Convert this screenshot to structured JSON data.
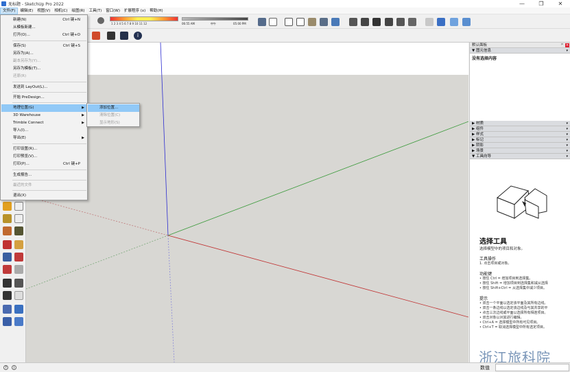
{
  "window": {
    "title": "无标题 - SketchUp Pro 2022",
    "minimize": "—",
    "maximize": "❐",
    "close": "✕"
  },
  "menubar": [
    {
      "key": "file",
      "label": "文件(F)"
    },
    {
      "key": "edit",
      "label": "编辑(E)"
    },
    {
      "key": "view",
      "label": "视图(V)"
    },
    {
      "key": "camera",
      "label": "相机(C)"
    },
    {
      "key": "draw",
      "label": "绘图(R)"
    },
    {
      "key": "tools",
      "label": "工具(T)"
    },
    {
      "key": "window",
      "label": "窗口(W)"
    },
    {
      "key": "extensions",
      "label": "扩展程序 (x)"
    },
    {
      "key": "help",
      "label": "帮助(H)"
    }
  ],
  "shadow_bar": {
    "months": "1 2 3 4 5 6 7 8 9 10 11 12",
    "time_start": "06:55 AM",
    "time_mid": "中午",
    "time_end": "05:00 PM"
  },
  "file_menu": {
    "items": [
      {
        "label": "新建(N)",
        "shortcut": "Ctrl 键+N",
        "disabled": false
      },
      {
        "label": "从模板新建...",
        "shortcut": "",
        "disabled": false
      },
      {
        "label": "打开(O)...",
        "shortcut": "Ctrl 键+O",
        "disabled": false
      },
      {
        "label": "保存(S)",
        "shortcut": "Ctrl 键+S",
        "disabled": false
      },
      {
        "label": "另存为(A)...",
        "shortcut": "",
        "disabled": false
      },
      {
        "label": "副本另存为(Y)...",
        "shortcut": "",
        "disabled": true
      },
      {
        "label": "另存为模板(T)...",
        "shortcut": "",
        "disabled": false
      },
      {
        "label": "还原(R)",
        "shortcut": "",
        "disabled": true
      },
      {
        "label": "发送到 LayOut(L)...",
        "shortcut": "",
        "disabled": false
      },
      {
        "label": "开始 PreDesign...",
        "shortcut": "",
        "disabled": false
      },
      {
        "label": "地理位置(G)",
        "shortcut": "",
        "disabled": false,
        "submenu": true
      },
      {
        "label": "3D Warehouse",
        "shortcut": "",
        "disabled": false,
        "submenu": true
      },
      {
        "label": "Trimble Connect",
        "shortcut": "",
        "disabled": false,
        "submenu": true
      },
      {
        "label": "导入(I)...",
        "shortcut": "",
        "disabled": false
      },
      {
        "label": "导出(E)",
        "shortcut": "",
        "disabled": false,
        "submenu": true
      },
      {
        "label": "打印设置(R)...",
        "shortcut": "",
        "disabled": false
      },
      {
        "label": "打印预览(V)...",
        "shortcut": "",
        "disabled": false
      },
      {
        "label": "打印(P)...",
        "shortcut": "Ctrl 键+P",
        "disabled": false
      },
      {
        "label": "生成报告...",
        "shortcut": "",
        "disabled": false
      },
      {
        "label": "最近的文件",
        "shortcut": "",
        "disabled": true
      },
      {
        "label": "退出(X)",
        "shortcut": "",
        "disabled": false
      }
    ]
  },
  "geo_submenu": {
    "items": [
      {
        "label": "添加位置...",
        "disabled": false
      },
      {
        "label": "清除位置(C)",
        "disabled": true
      },
      {
        "label": "显示地形(S)",
        "disabled": true
      }
    ]
  },
  "right_panel": {
    "header": "默认面板",
    "pin": "ᵖ",
    "close": "×",
    "entity_info": {
      "title": "图元信息",
      "body": "没有选择内容"
    },
    "trays": [
      "材质",
      "组件",
      "样式",
      "标记",
      "阴影",
      "场景",
      "工具向导"
    ],
    "instructor": {
      "title": "选择工具",
      "subtitle": "选择模型中的项目和对象。",
      "ops_h": "工具操作",
      "ops": [
        "1. 点击项目或对象。"
      ],
      "keys_h": "功能键",
      "keys": [
        "• 按住 Ctrl = 增加项目到选择集。",
        "• 按住 Shift = 增加项目到选择集和减从选择",
        "• 按住 Shift+Ctrl = 从选择集中减少项目。"
      ],
      "tips_h": "提示",
      "tips": [
        "• 双击一个平面以选定该平面及其所有边线。",
        "• 双击一条边线以选定该边线及与其共享的平",
        "• 点击三次边线或平面以选择所有相连项目。",
        "• 双击对象以对其进行编辑。",
        "• Ctrl+A = 选择模型中所有可见项目。",
        "• Ctrl+T = 取消选择模型中所有选定项目。"
      ]
    }
  },
  "watermark": "浙江旅科院",
  "status": {
    "measure_label": "数值"
  }
}
